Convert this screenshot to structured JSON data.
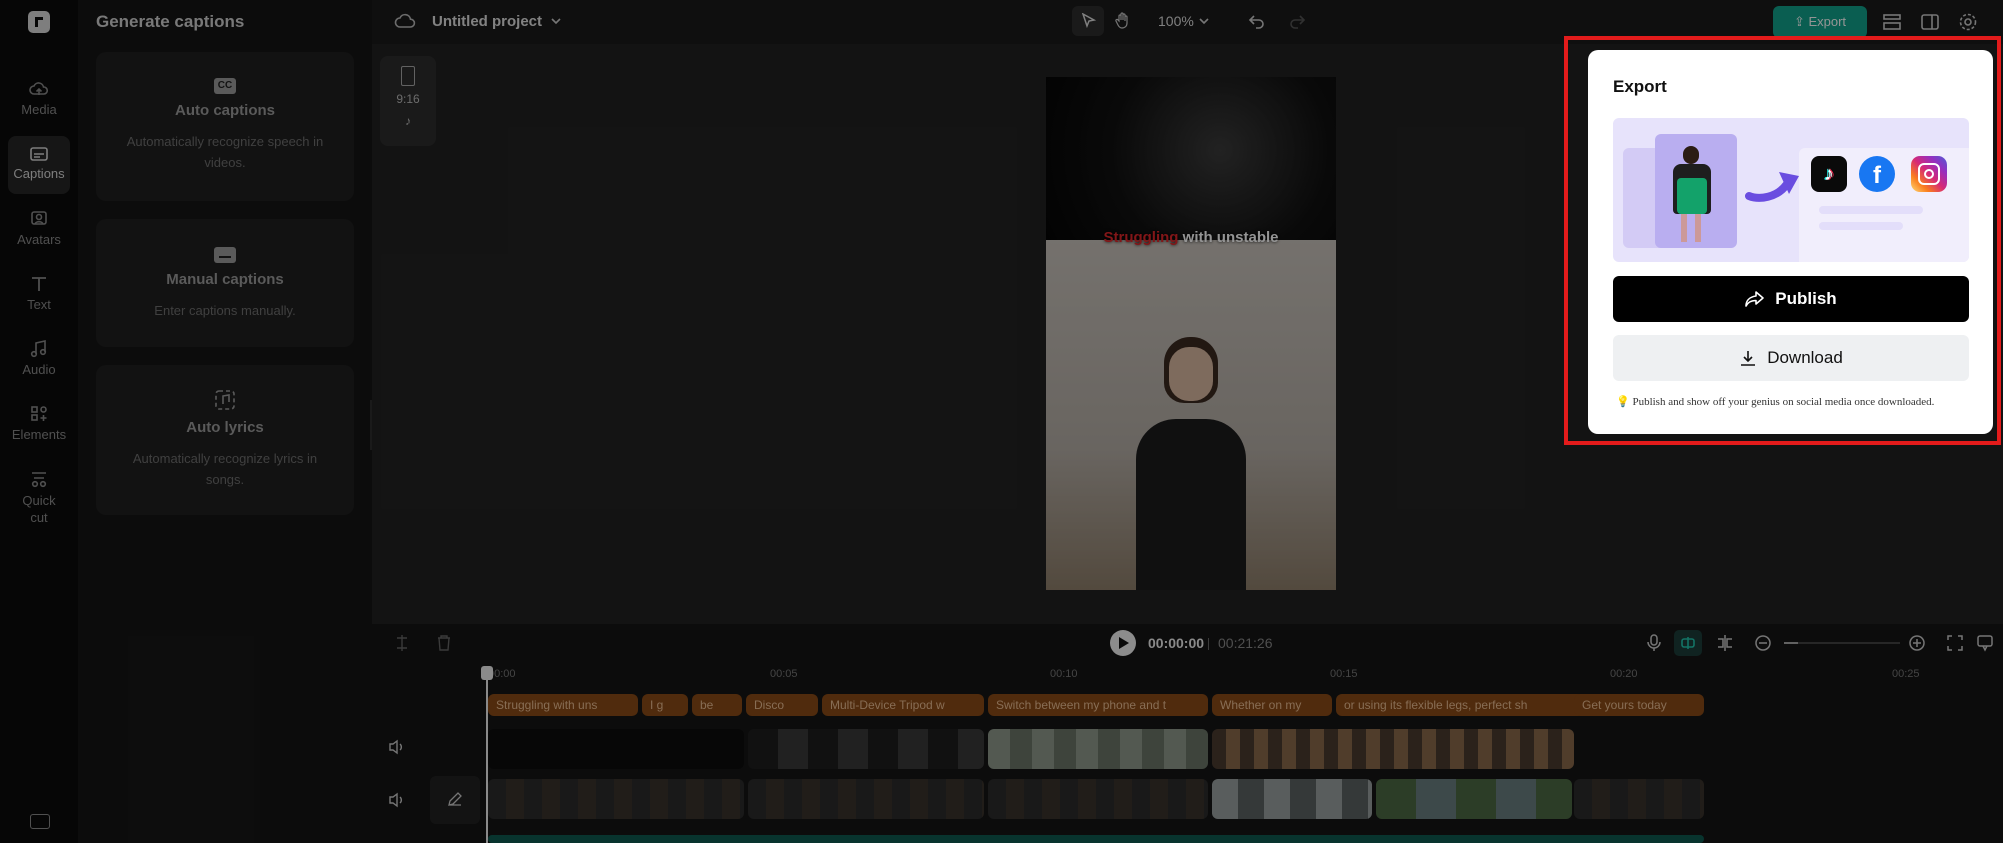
{
  "sidebar": {
    "items": [
      {
        "label": "Media",
        "icon": "cloud-icon"
      },
      {
        "label": "Captions",
        "icon": "captions-icon"
      },
      {
        "label": "Avatars",
        "icon": "avatar-icon"
      },
      {
        "label": "Text",
        "icon": "text-icon"
      },
      {
        "label": "Audio",
        "icon": "music-icon"
      },
      {
        "label": "Elements",
        "icon": "elements-icon"
      },
      {
        "label": "Quick",
        "label2": "cut",
        "icon": "scissors-icon"
      }
    ]
  },
  "panel": {
    "title": "Generate captions",
    "cards": [
      {
        "title": "Auto captions",
        "desc": "Automatically recognize speech in videos.",
        "icon": "cc-icon"
      },
      {
        "title": "Manual captions",
        "desc": "Enter captions manually.",
        "icon": "keyboard-icon"
      },
      {
        "title": "Auto lyrics",
        "desc": "Automatically recognize lyrics in songs.",
        "icon": "lyrics-icon"
      }
    ]
  },
  "topbar": {
    "project_title": "Untitled project",
    "zoom": "100%",
    "export_label": "Export"
  },
  "canvas": {
    "ratio": "9:16",
    "caption_highlight": "Struggling",
    "caption_rest": " with unstable"
  },
  "timeline": {
    "current_time": "00:00:00",
    "total_time": "00:21:26",
    "ruler": [
      "00:00",
      "00:05",
      "00:10",
      "00:15",
      "00:20",
      "00:25"
    ],
    "captions": [
      "Struggling with uns",
      "I g",
      "be",
      "Disco",
      "Multi-Device Tripod w",
      "Switch between my phone and t",
      "Whether on my",
      "or using its flexible legs, perfect sh",
      "Get yours today"
    ]
  },
  "export_popup": {
    "title": "Export",
    "publish_label": "Publish",
    "download_label": "Download",
    "footer": "Publish and show off your genius on social media once downloaded.",
    "colors": {
      "highlight": "#e31b1b",
      "publish_bg": "#000000",
      "banner_bg": "#e7e3fb"
    }
  }
}
